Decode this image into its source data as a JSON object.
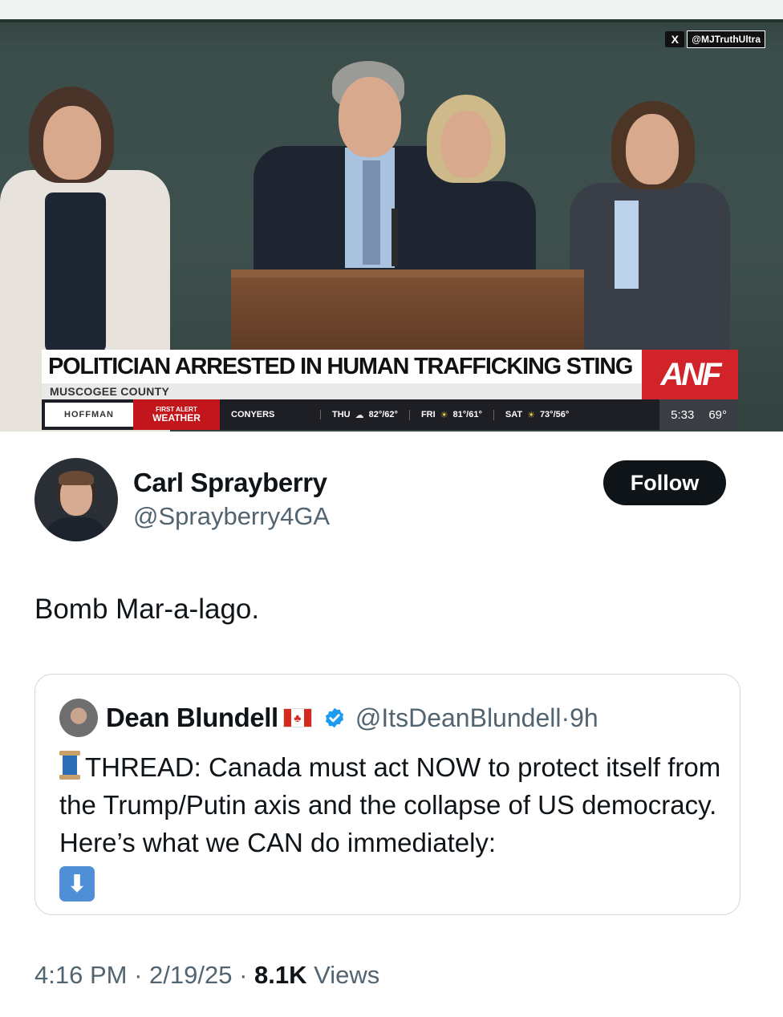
{
  "video": {
    "watermark": "@MJTruthUltra",
    "headline": "POLITICIAN ARRESTED IN HUMAN TRAFFICKING STING",
    "subhead": "MUSCOGEE COUNTY",
    "network_logo": "ANF",
    "ticker": {
      "sponsor": "HOFFMAN",
      "alert_top": "FIRST ALERT",
      "alert_bottom": "WEATHER",
      "city": "CONYERS",
      "days": [
        {
          "day": "THU",
          "icon": "cloud-icon",
          "temp": "82°/62°"
        },
        {
          "day": "FRI",
          "icon": "sun-cloud-icon",
          "temp": "81°/61°"
        },
        {
          "day": "SAT",
          "icon": "sun-cloud-icon",
          "temp": "73°/56°"
        }
      ],
      "time": "5:33",
      "current_temp": "69°"
    }
  },
  "tweet": {
    "display_name": "Carl Sprayberry",
    "handle": "@Sprayberry4GA",
    "follow_label": "Follow",
    "text": "Bomb Mar-a-lago.",
    "quoted": {
      "display_name": "Dean Blundell",
      "handle": "@ItsDeanBlundell",
      "separator": "·",
      "age": "9h",
      "text": "THREAD: Canada must act NOW to protect itself from the Trump/Putin axis and the collapse of US democracy. Here’s what we CAN do immediately:"
    },
    "time": "4:16 PM",
    "date": "2/19/25",
    "views_count": "8.1K",
    "views_label": "Views"
  },
  "colors": {
    "text_primary": "#0f1419",
    "text_secondary": "#536471",
    "verified_blue": "#1d9bf0",
    "news_red": "#d2232a"
  }
}
